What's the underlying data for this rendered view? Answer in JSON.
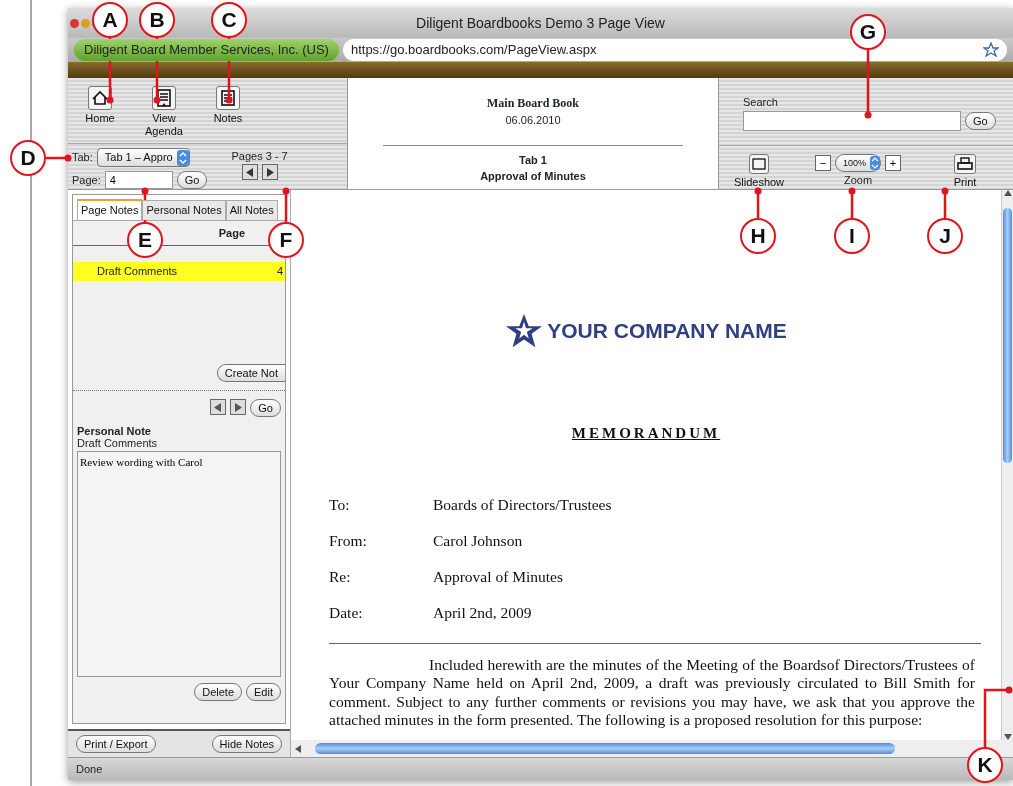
{
  "window": {
    "title": "Diligent Boardbooks Demo 3 Page View"
  },
  "address_bar": {
    "site_identity": "Diligent Board Member Services, Inc. (US)",
    "url": "https://go.boardbooks.com/PageView.aspx"
  },
  "toolbar": {
    "buttons": [
      {
        "label": "Home",
        "kind": "home"
      },
      {
        "label": "View Agenda",
        "kind": "agenda"
      },
      {
        "label": "Notes",
        "kind": "notes"
      }
    ]
  },
  "navigation": {
    "tab_label": "Tab:",
    "tab_value": "Tab 1 – Appro",
    "page_label": "Page:",
    "page_value": "4",
    "go": "Go",
    "pages_range": "Pages 3 - 7"
  },
  "book_header": {
    "title": "Main Board Book",
    "date": "06.06.2010",
    "tab": "Tab 1",
    "section": "Approval of Minutes"
  },
  "search": {
    "label": "Search",
    "button": "Go"
  },
  "view_controls": {
    "slideshow": "Slideshow",
    "minus": "−",
    "zoom_value": "100%",
    "plus": "+",
    "zoom_label": "Zoom",
    "print": "Print"
  },
  "notes_panel": {
    "tabs": [
      {
        "label": "Page Notes",
        "selected": true
      },
      {
        "label": "Personal Notes",
        "selected": false
      },
      {
        "label": "All Notes",
        "selected": false
      }
    ],
    "column_header": "Page",
    "notes": [
      {
        "title": "Draft Comments",
        "page": "4",
        "selected": true
      }
    ],
    "create_button": "Create Not",
    "go_button": "Go",
    "note_heading": "Personal Note",
    "note_title": "Draft Comments",
    "note_text": "Review wording with Carol",
    "buttons": [
      "Delete",
      "Edit"
    ]
  },
  "bottom_buttons": [
    "Print / Export",
    "Hide Notes"
  ],
  "document": {
    "company": "YOUR COMPANY NAME",
    "heading": "MEMORANDUM",
    "fields": [
      {
        "label": "To:",
        "value": "Boards of Directors/Trustees"
      },
      {
        "label": "From:",
        "value": "Carol Johnson"
      },
      {
        "label": "Re:",
        "value": "Approval of Minutes"
      },
      {
        "label": "Date:",
        "value": "April 2nd, 2009"
      }
    ],
    "body": "Included herewith are the minutes of the Meeting of the Boardsof Directors/Trustees of Your Company Name held on April 2nd, 2009, a draft was previously circulated to Bill Smith for comment.  Subject to any further comments or revisions you may have, we ask that you approve the attached minutes in the form presented.  The following is a proposed resolution for this purpose:"
  },
  "status_bar": {
    "text": "Done"
  },
  "callouts": [
    {
      "label": "A"
    },
    {
      "label": "B"
    },
    {
      "label": "C"
    },
    {
      "label": "D"
    },
    {
      "label": "E"
    },
    {
      "label": "F"
    },
    {
      "label": "G"
    },
    {
      "label": "H"
    },
    {
      "label": "I"
    },
    {
      "label": "J"
    },
    {
      "label": "K"
    }
  ]
}
